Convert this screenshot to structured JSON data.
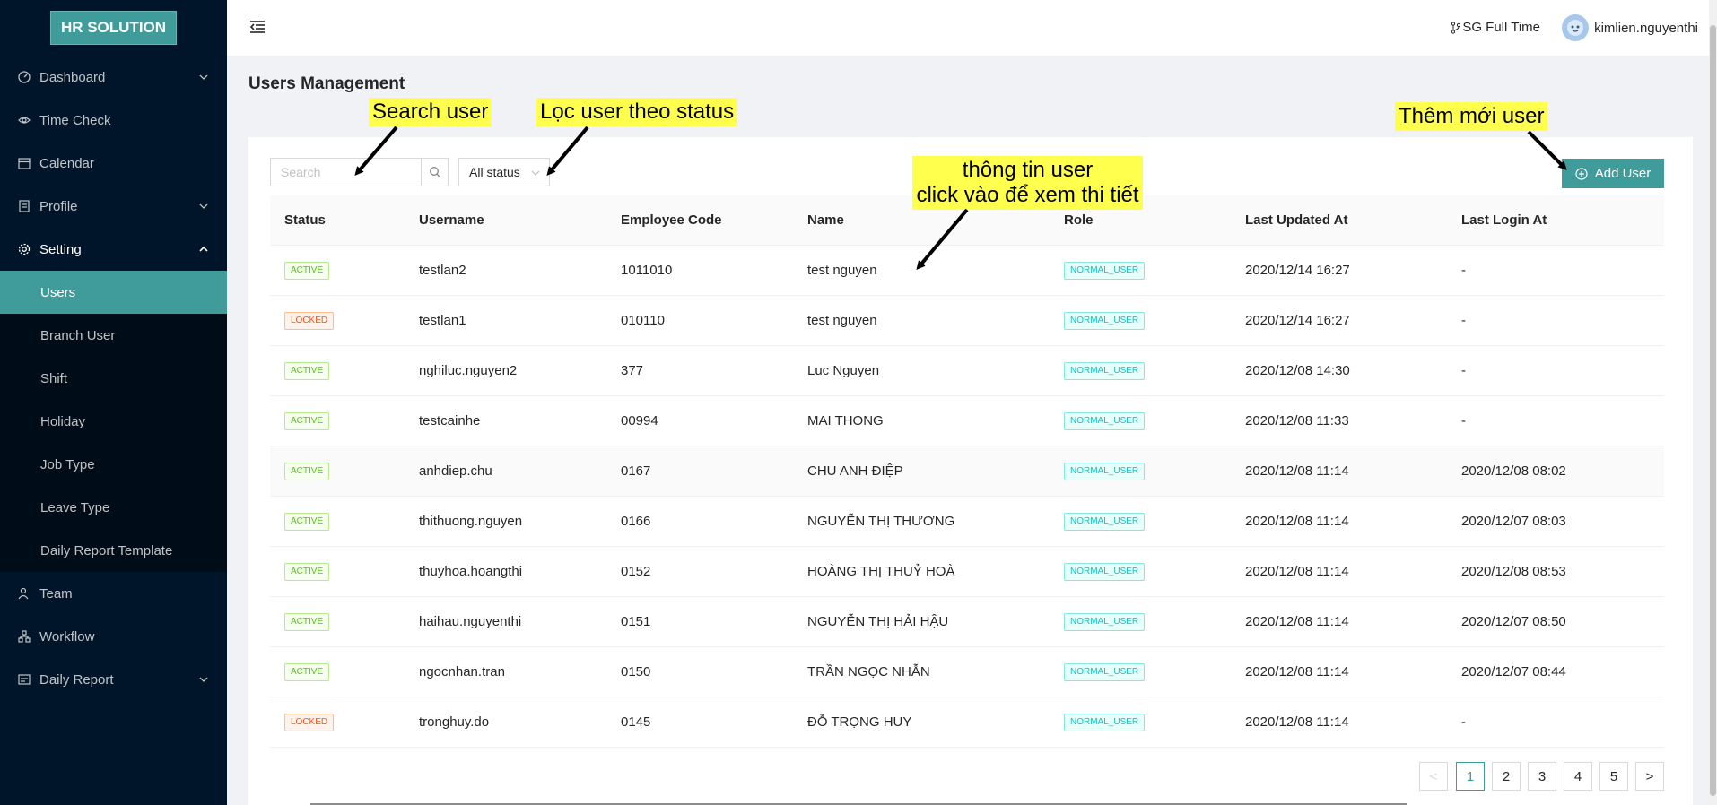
{
  "app": {
    "logo": "HR SOLUTION"
  },
  "sidebar": {
    "items": [
      {
        "label": "Dashboard"
      },
      {
        "label": "Time Check"
      },
      {
        "label": "Calendar"
      },
      {
        "label": "Profile"
      },
      {
        "label": "Setting"
      },
      {
        "label": "Team"
      },
      {
        "label": "Workflow"
      },
      {
        "label": "Daily Report"
      }
    ],
    "setting_children": [
      {
        "label": "Users"
      },
      {
        "label": "Branch User"
      },
      {
        "label": "Shift"
      },
      {
        "label": "Holiday"
      },
      {
        "label": "Job Type"
      },
      {
        "label": "Leave Type"
      },
      {
        "label": "Daily Report Template"
      }
    ]
  },
  "header": {
    "branch": "SG Full Time",
    "username": "kimlien.nguyenthi"
  },
  "page": {
    "title": "Users Management"
  },
  "toolbar": {
    "search_placeholder": "Search",
    "status_value": "All status",
    "add_label": "Add User"
  },
  "table": {
    "columns": [
      "Status",
      "Username",
      "Employee Code",
      "Name",
      "Role",
      "Last Updated At",
      "Last Login At"
    ],
    "rows": [
      {
        "status": "ACTIVE",
        "username": "testlan2",
        "code": "1011010",
        "name": "test nguyen",
        "role": "NORMAL_USER",
        "updated": "2020/12/14 16:27",
        "login": "-"
      },
      {
        "status": "LOCKED",
        "username": "testlan1",
        "code": "010110",
        "name": "test nguyen",
        "role": "NORMAL_USER",
        "updated": "2020/12/14 16:27",
        "login": "-"
      },
      {
        "status": "ACTIVE",
        "username": "nghiluc.nguyen2",
        "code": "377",
        "name": "Luc Nguyen",
        "role": "NORMAL_USER",
        "updated": "2020/12/08 14:30",
        "login": "-"
      },
      {
        "status": "ACTIVE",
        "username": "testcainhe",
        "code": "00994",
        "name": "MAI THONG",
        "role": "NORMAL_USER",
        "updated": "2020/12/08 11:33",
        "login": "-"
      },
      {
        "status": "ACTIVE",
        "username": "anhdiep.chu",
        "code": "0167",
        "name": "CHU ANH ĐIỆP",
        "role": "NORMAL_USER",
        "updated": "2020/12/08 11:14",
        "login": "2020/12/08 08:02"
      },
      {
        "status": "ACTIVE",
        "username": "thithuong.nguyen",
        "code": "0166",
        "name": "NGUYỄN THỊ THƯƠNG",
        "role": "NORMAL_USER",
        "updated": "2020/12/08 11:14",
        "login": "2020/12/07 08:03"
      },
      {
        "status": "ACTIVE",
        "username": "thuyhoa.hoangthi",
        "code": "0152",
        "name": "HOÀNG THỊ THUỶ HOÀ",
        "role": "NORMAL_USER",
        "updated": "2020/12/08 11:14",
        "login": "2020/12/08 08:53"
      },
      {
        "status": "ACTIVE",
        "username": "haihau.nguyenthi",
        "code": "0151",
        "name": "NGUYỄN THỊ HẢI HẬU",
        "role": "NORMAL_USER",
        "updated": "2020/12/08 11:14",
        "login": "2020/12/07 08:50"
      },
      {
        "status": "ACTIVE",
        "username": "ngocnhan.tran",
        "code": "0150",
        "name": "TRẦN NGỌC NHẪN",
        "role": "NORMAL_USER",
        "updated": "2020/12/08 11:14",
        "login": "2020/12/07 08:44"
      },
      {
        "status": "LOCKED",
        "username": "tronghuy.do",
        "code": "0145",
        "name": "ĐỖ TRỌNG HUY",
        "role": "NORMAL_USER",
        "updated": "2020/12/08 11:14",
        "login": "-"
      }
    ]
  },
  "pagination": {
    "prev": "<",
    "pages": [
      "1",
      "2",
      "3",
      "4",
      "5"
    ],
    "next": ">",
    "current": "1"
  },
  "annotations": {
    "search": "Search user",
    "filter": "Lọc user theo status",
    "add": "Thêm mới user",
    "info_line1": "thông tin user",
    "info_line2": "click vào để xem thi tiết"
  },
  "colors": {
    "accent": "#3f9c9b",
    "sidebar_bg": "#001529",
    "annotation_bg": "#ffff4d"
  }
}
